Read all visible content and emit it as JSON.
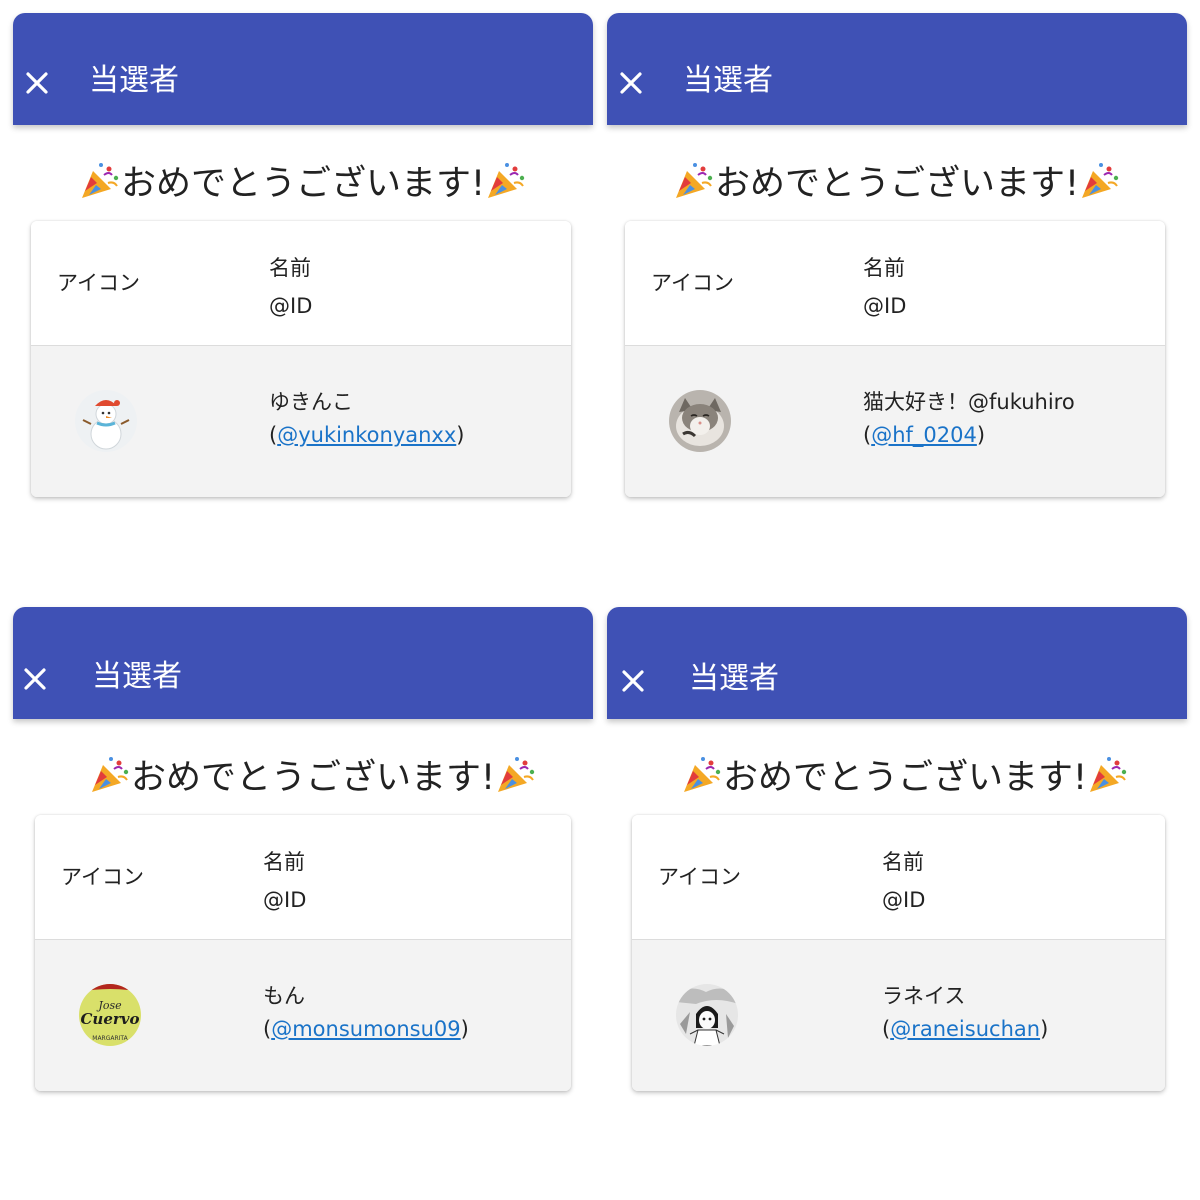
{
  "colors": {
    "appbar": "#3f51b5",
    "link": "#1a73c8",
    "row_bg": "#f3f3f3"
  },
  "common": {
    "title": "当選者",
    "congrats_text": "おめでとうございます!",
    "col_icon": "アイコン",
    "col_name": "名前",
    "col_id": "@ID",
    "close_icon": "close-icon",
    "popper_icon": "party-popper-icon"
  },
  "panels": [
    {
      "winner_name": "ゆきんこ",
      "winner_handle": "@yukinkonyanxx",
      "avatar": "snowman-avatar"
    },
    {
      "winner_name": "猫大好き！@fukuhiro",
      "winner_handle": "@hf_0204",
      "avatar": "cat-avatar"
    },
    {
      "winner_name": "もん",
      "winner_handle": "@monsumonsu09",
      "avatar": "jose-cuervo-avatar",
      "avatar_text": [
        "Jose",
        "Cuervo",
        "MARGARITA"
      ]
    },
    {
      "winner_name": "ラネイス",
      "winner_handle": "@raneisuchan",
      "avatar": "manga-avatar"
    }
  ]
}
